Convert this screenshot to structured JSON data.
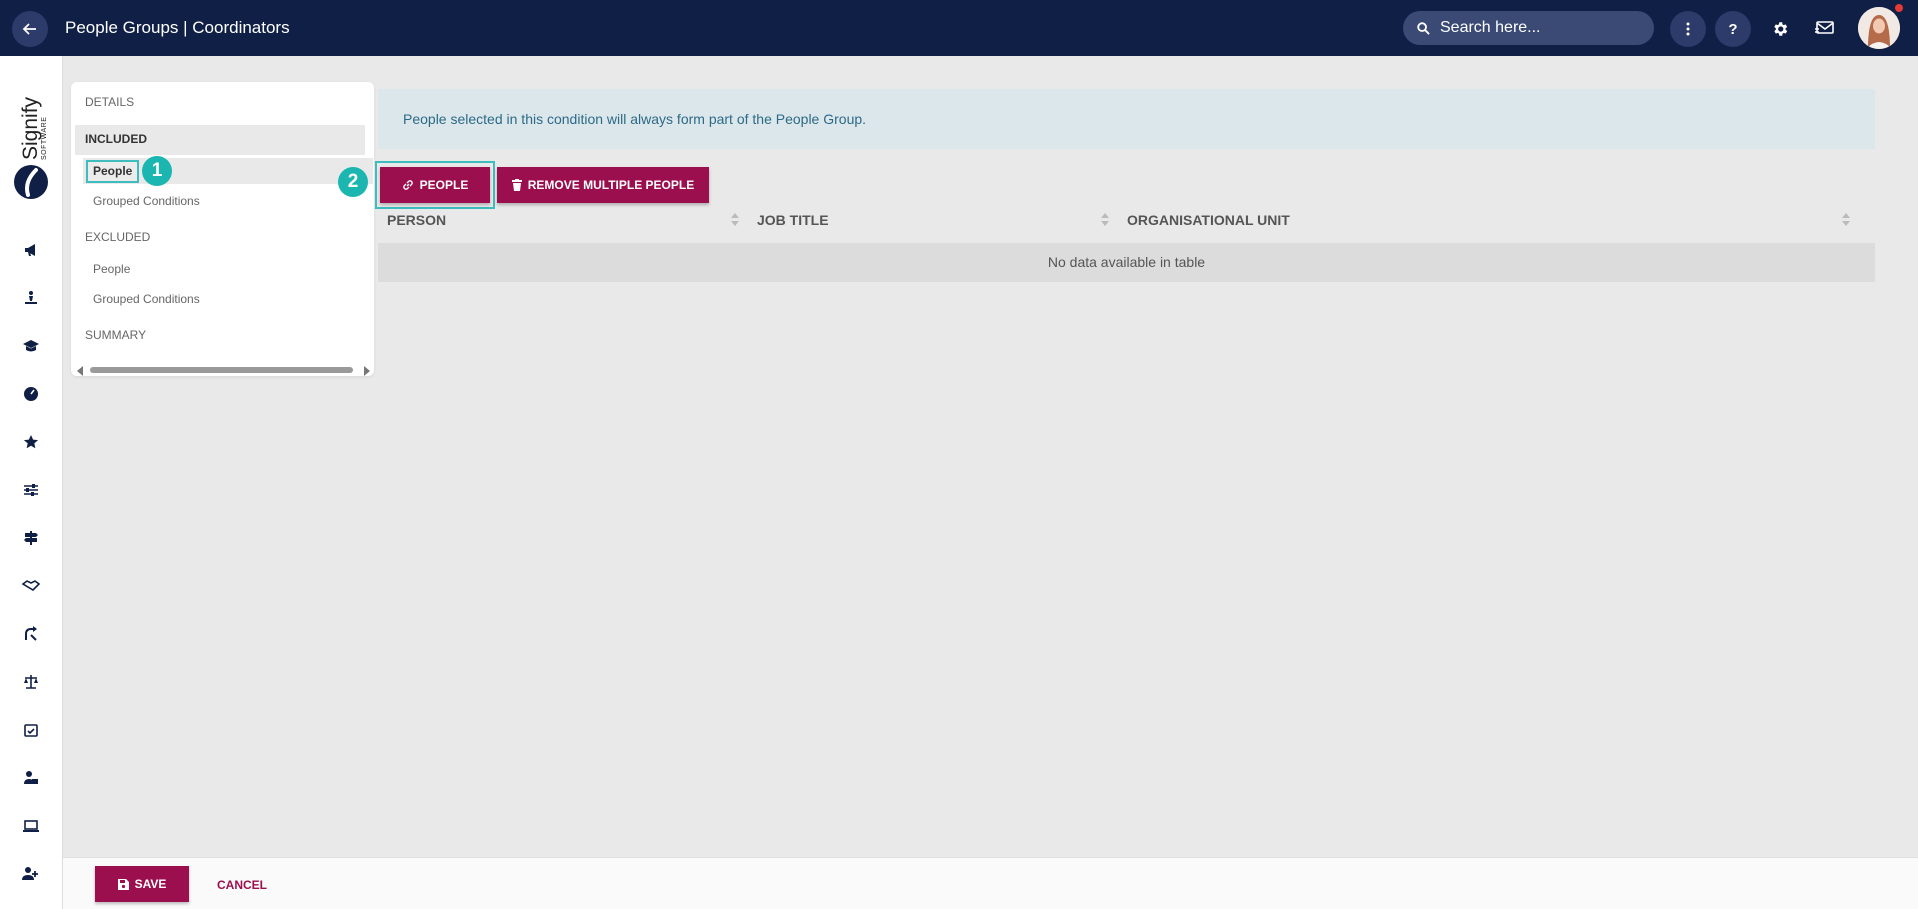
{
  "header": {
    "title": "People Groups | Coordinators",
    "search_placeholder": "Search here..."
  },
  "logo": {
    "brand": "Signify",
    "sub": "SOFTWARE"
  },
  "panel": {
    "details": "DETAILS",
    "included": "INCLUDED",
    "included_people": "People",
    "included_grouped": "Grouped Conditions",
    "excluded": "EXCLUDED",
    "excluded_people": "People",
    "excluded_grouped": "Grouped Conditions",
    "summary": "SUMMARY"
  },
  "steps": {
    "one": "1",
    "two": "2"
  },
  "info_text": "People selected in this condition will always form part of the People Group.",
  "actions": {
    "people_label": "PEOPLE",
    "remove_label": "REMOVE MULTIPLE PEOPLE"
  },
  "table": {
    "columns": [
      "PERSON",
      "JOB TITLE",
      "ORGANISATIONAL UNIT"
    ],
    "empty_text": "No data available in table"
  },
  "footer": {
    "save_label": "SAVE",
    "cancel_label": "CANCEL"
  },
  "colors": {
    "topbar": "#0f1f45",
    "accent": "#9c0f4e",
    "highlight": "#3dbdbd",
    "step_badge": "#1bb6b0"
  }
}
